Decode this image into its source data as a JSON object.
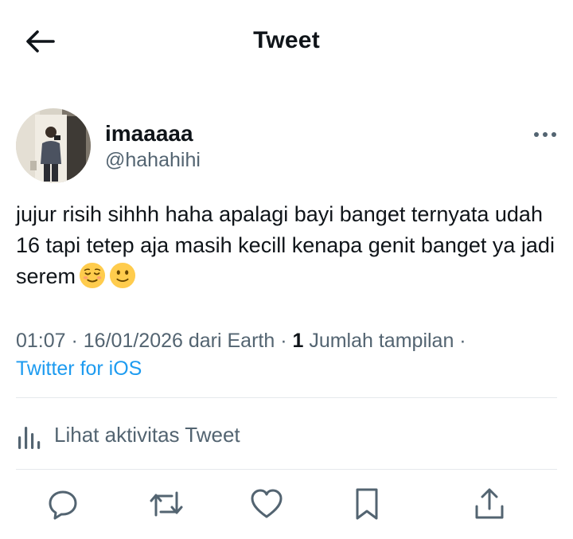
{
  "header": {
    "title": "Tweet",
    "back_icon": "arrow-left-icon"
  },
  "author": {
    "display_name": "imaaaaa",
    "handle": "@hahahihi",
    "avatar_icon": "profile-avatar-photo",
    "more_icon": "more-horizontal-icon"
  },
  "tweet": {
    "text": "jujur risih sihhh haha apalagi bayi banget ternyata udah 16 tapi tetep aja masih kecill kenapa genit banget ya jadi serem",
    "emojis": [
      "relieved-face-emoji",
      "slightly-smiling-face-emoji"
    ]
  },
  "meta": {
    "time": "01:07",
    "date": "16/01/2026",
    "location_prefix": "dari Earth",
    "views_count": "1",
    "views_label": "Jumlah tampilan",
    "source": "Twitter for iOS",
    "source_color": "#1d9bf0"
  },
  "activity": {
    "label": "Lihat aktivitas Tweet",
    "icon": "bar-chart-icon"
  },
  "actions": {
    "reply_icon": "reply-icon",
    "retweet_icon": "retweet-icon",
    "like_icon": "heart-icon",
    "bookmark_icon": "bookmark-icon",
    "share_icon": "share-icon"
  },
  "colors": {
    "text": "#0f1419",
    "secondary": "#536471",
    "divider": "#e6e9ec"
  }
}
